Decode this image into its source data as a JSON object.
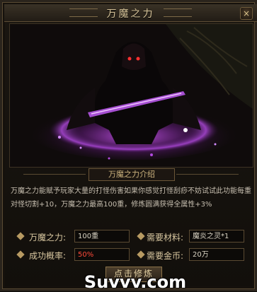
{
  "window": {
    "title": "万魔之力",
    "close_glyph": "×"
  },
  "intro": {
    "heading": "万魔之力介绍",
    "description": "万魔之力能赋予玩家大量的打怪伤害如果你感觉打怪刮痧不妨试试此功能每重对怪切割+10，万魔之力最高100重，修炼圆满获得全属性+3%"
  },
  "stats": {
    "power_label": "万魔之力:",
    "power_value": "100重",
    "success_label": "成功概率:",
    "success_value": "50%",
    "material_label": "需要材料:",
    "material_value": "魔炎之灵*1",
    "gold_label": "需要金币:",
    "gold_value": "20万"
  },
  "actions": {
    "craft_label": "点击修炼"
  },
  "watermark": "Suvvv.com",
  "colors": {
    "gold": "#d9c7a0",
    "purple_glow": "#b24ae0",
    "red_value": "#ff4a3a"
  }
}
